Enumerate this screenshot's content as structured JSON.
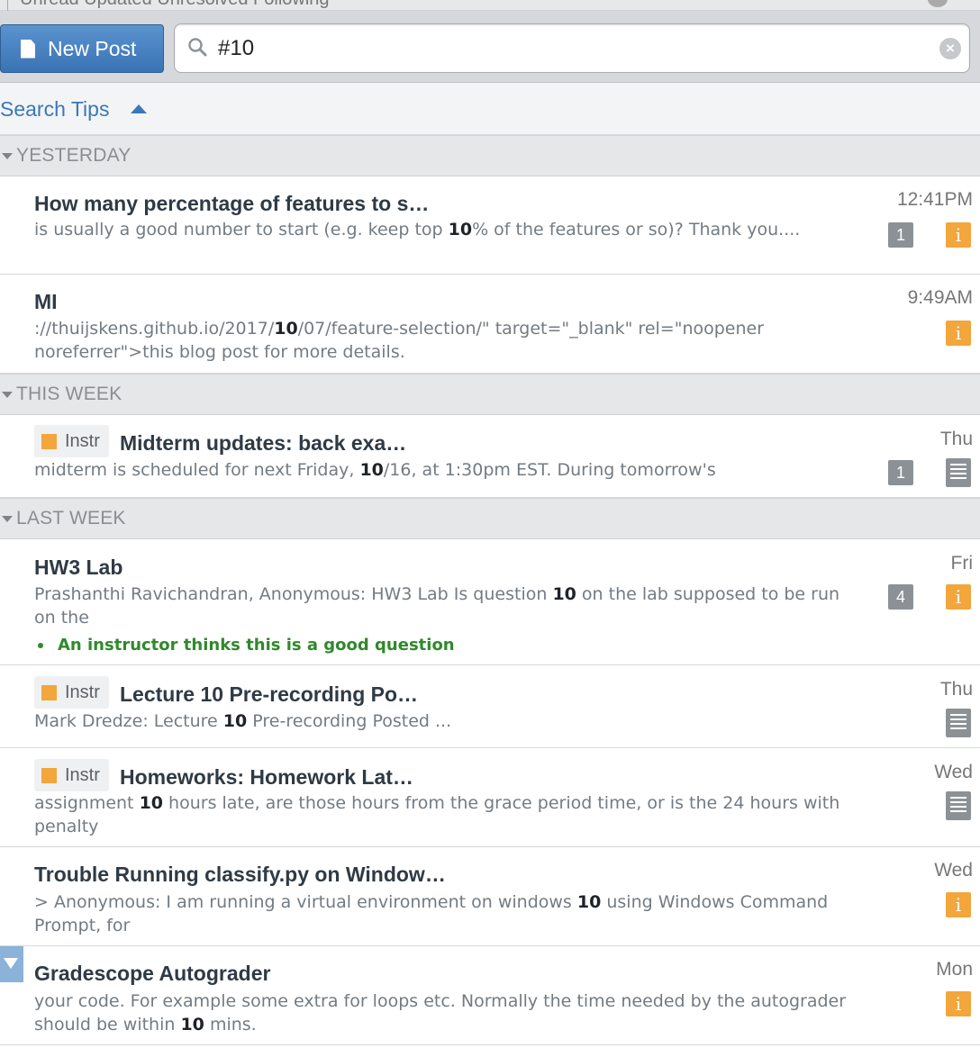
{
  "filters": {
    "text": "Unread   Updated   Unresolved   Following"
  },
  "toolbar": {
    "new_post_label": "New Post",
    "search_value": "#10"
  },
  "search_tips": {
    "label": "Search Tips"
  },
  "groups": {
    "yesterday": "YESTERDAY",
    "this_week": "THIS WEEK",
    "last_week": "LAST WEEK"
  },
  "instr_label": "Instr",
  "posts": [
    {
      "title": "How many percentage of features to s…",
      "snippet_a": "is usually a good number to start (e.g. keep top ",
      "hl": "10",
      "snippet_b": "% of the features or so)? Thank you....",
      "time": "12:41PM",
      "count": "1",
      "icon": "question-icon"
    },
    {
      "title": "MI",
      "snippet_a": "://thuijskens.github.io/2017/",
      "hl": "10",
      "snippet_b": "/07/feature-selection/\" target=\"_blank\" rel=\"noopener noreferrer\">this blog post for more details.",
      "time": "9:49AM",
      "icon": "question-icon"
    },
    {
      "title": "Midterm updates: back exa…",
      "snippet_a": "midterm is scheduled for next Friday, ",
      "hl": "10",
      "snippet_b": "/16, at 1:30pm EST. During tomorrow's",
      "time": "Thu",
      "count": "1",
      "icon": "note-icon"
    },
    {
      "title": "HW3 Lab",
      "snippet_a": "Prashanthi Ravichandran, Anonymous: HW3 Lab Is question ",
      "hl": "10",
      "snippet_b": " on the lab supposed to be run on the",
      "time": "Fri",
      "count": "4",
      "icon": "question-icon",
      "endorsement": "An instructor thinks this is a good question"
    },
    {
      "title": "Lecture 10 Pre-recording Po…",
      "snippet_a": "Mark Dredze: Lecture ",
      "hl": "10",
      "snippet_b": " Pre-recording Posted ...",
      "time": "Thu",
      "icon": "note-icon"
    },
    {
      "title": "Homeworks: Homework Lat…",
      "snippet_a": "assignment ",
      "hl": "10",
      "snippet_b": " hours late, are those hours from the grace period time, or is the 24 hours with penalty",
      "time": "Wed",
      "icon": "note-icon"
    },
    {
      "title": "Trouble Running classify.py on Window…",
      "snippet_a": "> Anonymous: I am running a virtual environment on windows ",
      "hl": "10",
      "snippet_b": " using Windows Command Prompt, for",
      "time": "Wed",
      "icon": "question-icon"
    },
    {
      "title": "Gradescope Autograder",
      "snippet_a": "your code. For example some extra for loops etc. Normally the time needed by the autograder should be within ",
      "hl": "10",
      "snippet_b": " mins.",
      "time": "Mon",
      "icon": "question-icon"
    }
  ],
  "colors": {
    "accent": "#3a78b8",
    "question": "#f2a63c",
    "badge": "#8c9196",
    "endorse": "#2f8a2b"
  }
}
